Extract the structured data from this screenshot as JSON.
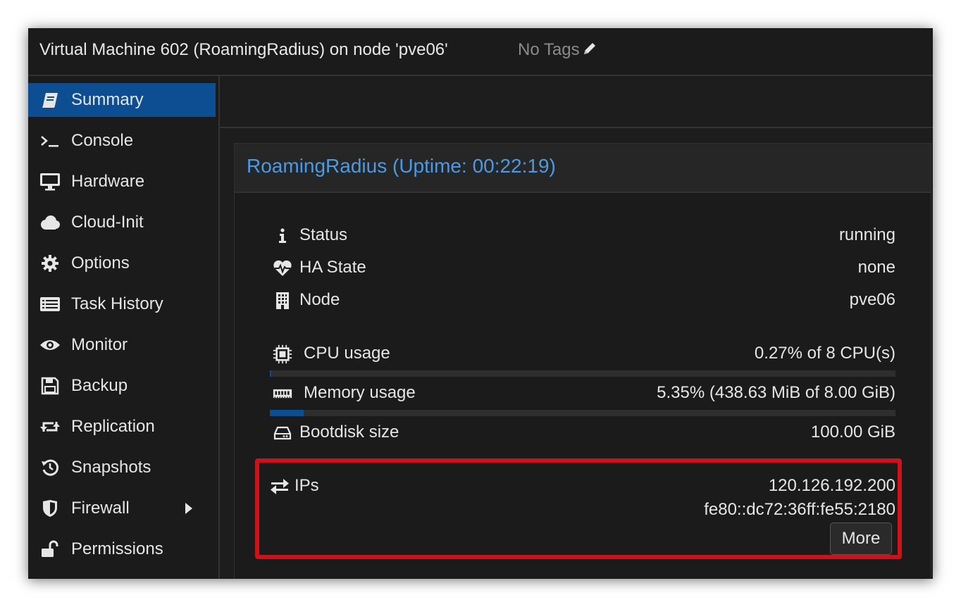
{
  "header": {
    "title": "Virtual Machine 602 (RoamingRadius) on node 'pve06'",
    "tags_label": "No Tags"
  },
  "sidebar": {
    "items": [
      {
        "label": "Summary",
        "icon": "book-icon",
        "active": true
      },
      {
        "label": "Console",
        "icon": "terminal-icon"
      },
      {
        "label": "Hardware",
        "icon": "monitor-icon"
      },
      {
        "label": "Cloud-Init",
        "icon": "cloud-icon"
      },
      {
        "label": "Options",
        "icon": "gear-icon"
      },
      {
        "label": "Task History",
        "icon": "list-icon"
      },
      {
        "label": "Monitor",
        "icon": "eye-icon"
      },
      {
        "label": "Backup",
        "icon": "floppy-icon"
      },
      {
        "label": "Replication",
        "icon": "retweet-icon"
      },
      {
        "label": "Snapshots",
        "icon": "history-icon"
      },
      {
        "label": "Firewall",
        "icon": "shield-icon",
        "has_submenu": true
      },
      {
        "label": "Permissions",
        "icon": "unlock-icon"
      }
    ]
  },
  "summary": {
    "title": "RoamingRadius (Uptime: 00:22:19)",
    "status": {
      "label": "Status",
      "value": "running"
    },
    "ha_state": {
      "label": "HA State",
      "value": "none"
    },
    "node": {
      "label": "Node",
      "value": "pve06"
    },
    "cpu": {
      "label": "CPU usage",
      "value": "0.27% of 8 CPU(s)",
      "fraction": 0.0027
    },
    "memory": {
      "label": "Memory usage",
      "value": "5.35% (438.63 MiB of 8.00 GiB)",
      "fraction": 0.0535
    },
    "bootdisk": {
      "label": "Bootdisk size",
      "value": "100.00 GiB"
    },
    "ips": {
      "label": "IPs",
      "values": [
        "120.126.192.200",
        "fe80::dc72:36ff:fe55:2180"
      ],
      "more_label": "More"
    }
  },
  "colors": {
    "accent": "#0d4d92",
    "title_blue": "#4a9ae4",
    "highlight_red": "#d0111b",
    "background": "#1d1d1d"
  }
}
